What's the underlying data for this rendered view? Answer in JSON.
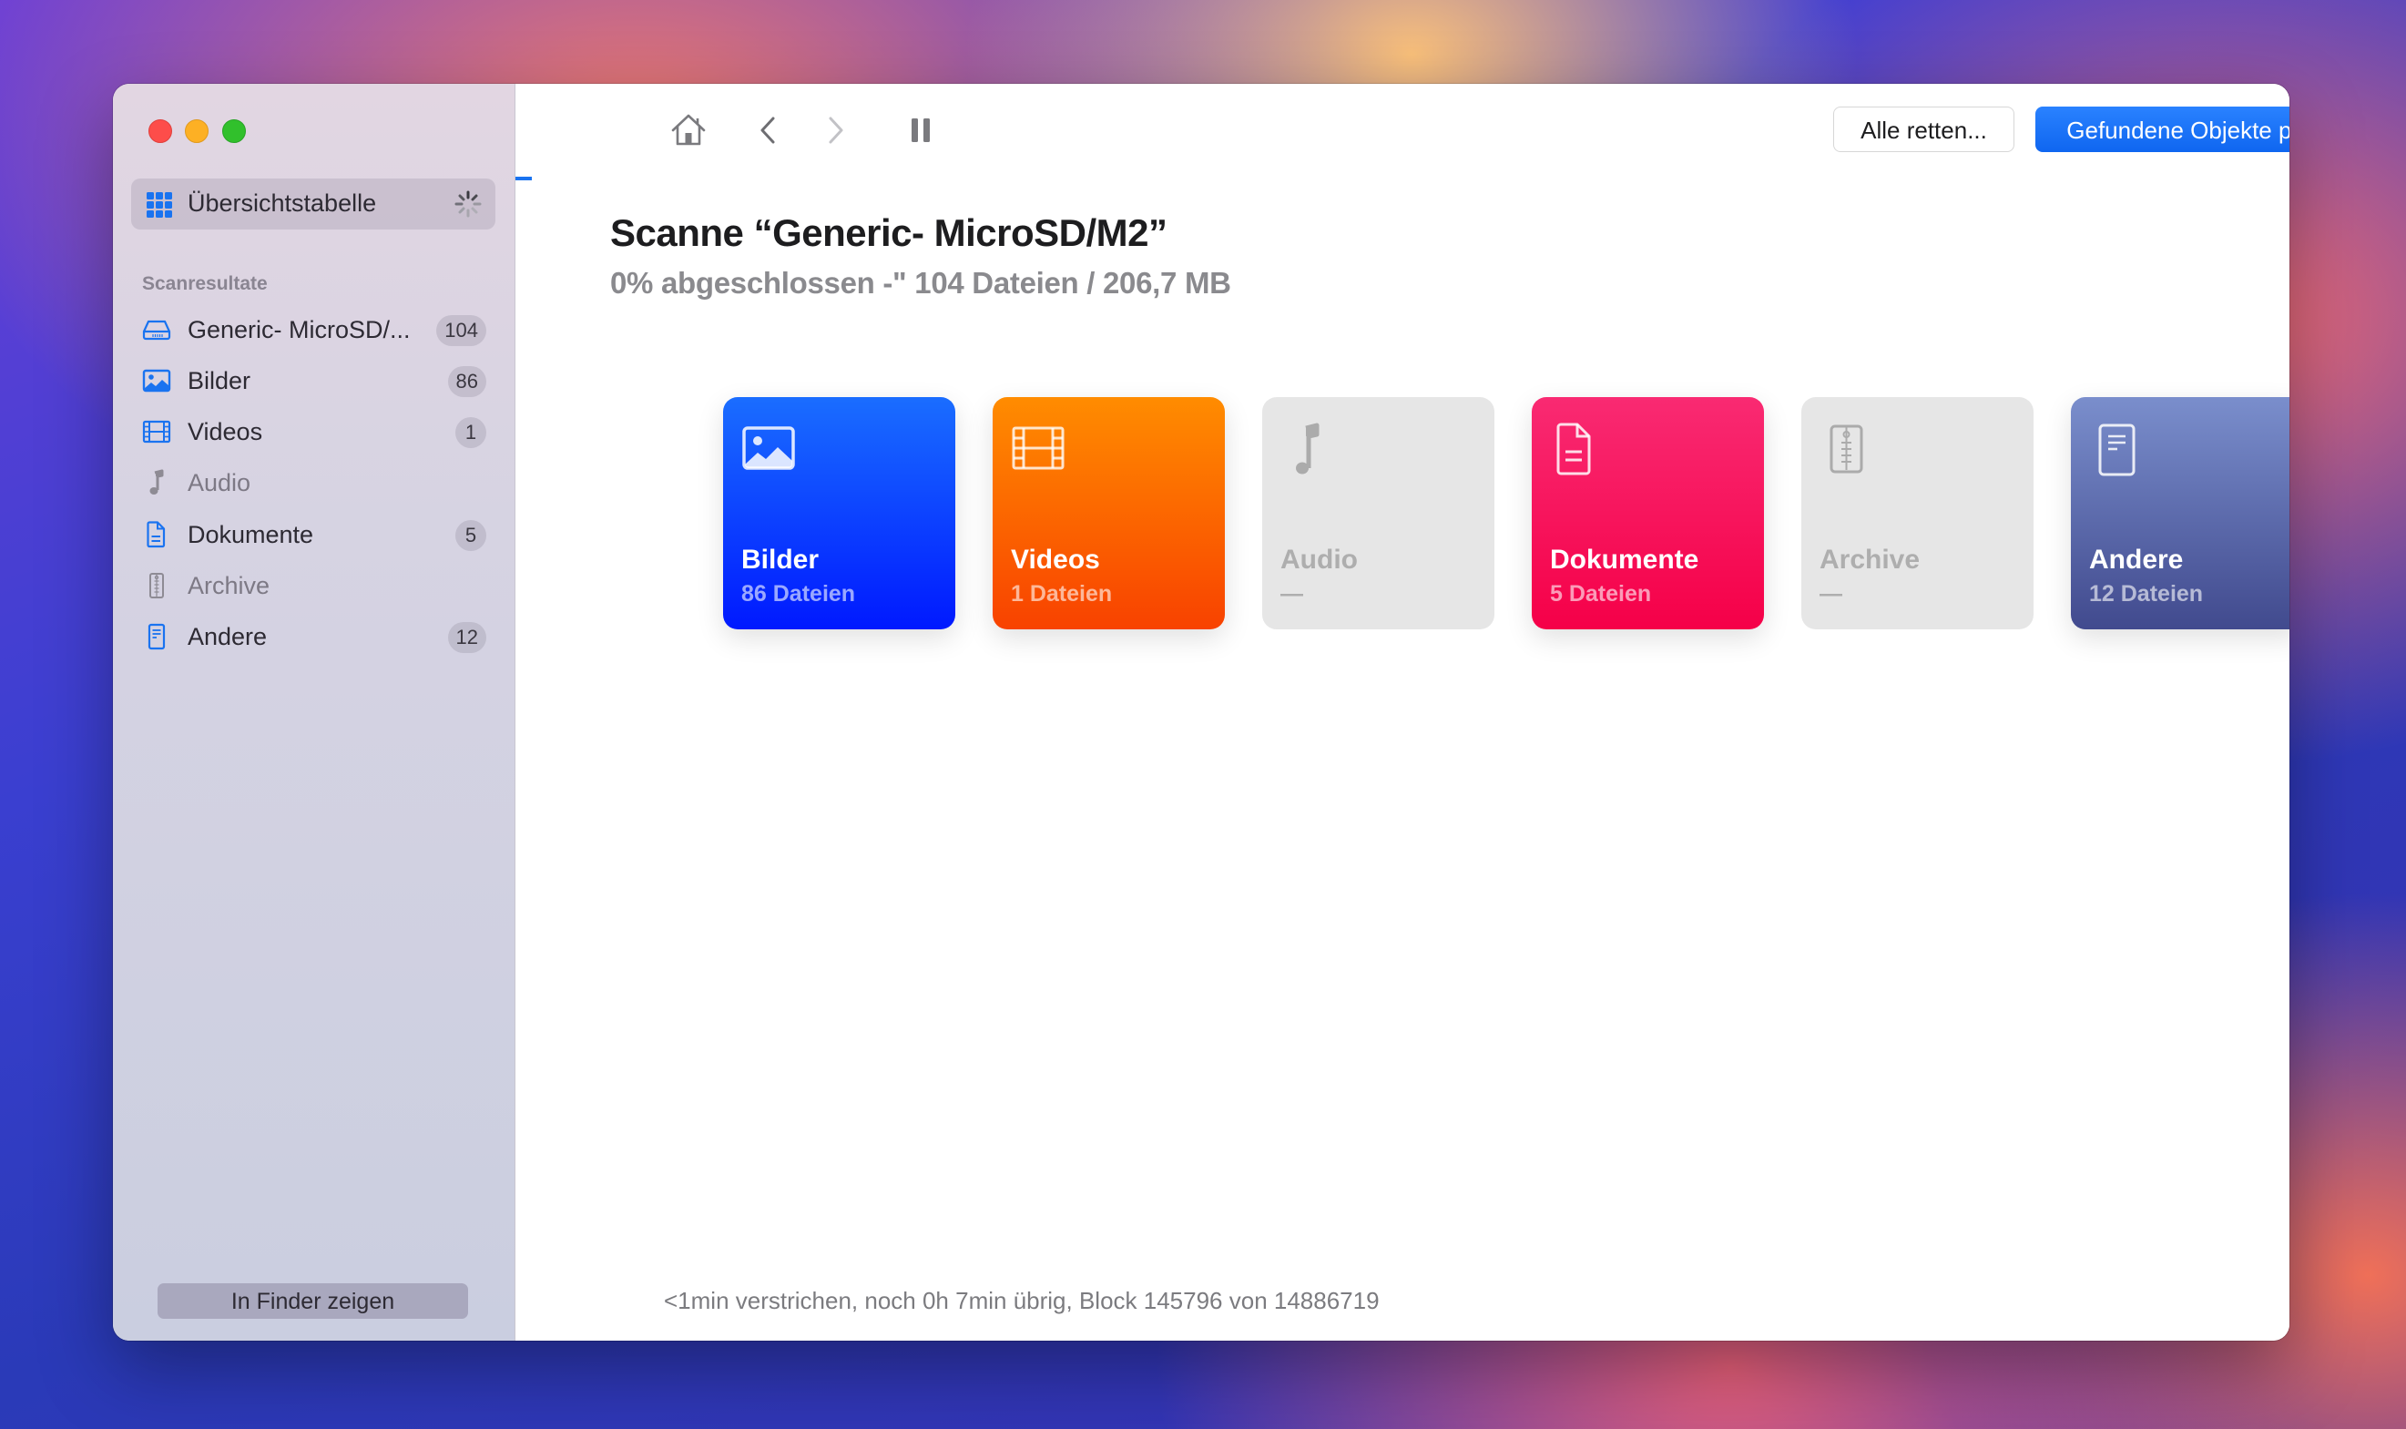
{
  "window": {
    "traffic_lights": [
      "close",
      "minimize",
      "zoom"
    ]
  },
  "sidebar": {
    "overview": {
      "label": "Übersichtstabelle",
      "icon": "grid-icon",
      "status_icon": "spinner-icon"
    },
    "section_header": "Scanresultate",
    "items": [
      {
        "label": "Generic- MicroSD/...",
        "count": "104",
        "icon": "drive-icon",
        "enabled": true
      },
      {
        "label": "Bilder",
        "count": "86",
        "icon": "photo-icon",
        "enabled": true
      },
      {
        "label": "Videos",
        "count": "1",
        "icon": "film-icon",
        "enabled": true
      },
      {
        "label": "Audio",
        "count": null,
        "icon": "music-note-icon",
        "enabled": false
      },
      {
        "label": "Dokumente",
        "count": "5",
        "icon": "document-icon",
        "enabled": true
      },
      {
        "label": "Archive",
        "count": null,
        "icon": "archive-zip-icon",
        "enabled": false
      },
      {
        "label": "Andere",
        "count": "12",
        "icon": "other-file-icon",
        "enabled": true
      }
    ],
    "finder_button": "In Finder zeigen"
  },
  "toolbar": {
    "icons": [
      "home-icon",
      "back-icon",
      "forward-icon",
      "pause-icon"
    ],
    "recover_all_label": "Alle retten...",
    "review_label": "Gefundene Objekte prüfen"
  },
  "main": {
    "title": "Scanne “Generic- MicroSD/M2”",
    "subtitle": "0% abgeschlossen -\" 104 Dateien / 206,7 MB",
    "scan_progress_percent": 0,
    "cards": [
      {
        "name": "Bilder",
        "count": "86 Dateien",
        "icon": "photo-icon",
        "active": true,
        "colors": [
          "#1a6dff",
          "#0019ff"
        ]
      },
      {
        "name": "Videos",
        "count": "1 Dateien",
        "icon": "film-icon",
        "active": true,
        "colors": [
          "#ff8c00",
          "#f84200"
        ]
      },
      {
        "name": "Audio",
        "count": "—",
        "icon": "music-note-icon",
        "active": false,
        "colors": [
          "#e6e6e6",
          "#e6e6e6"
        ]
      },
      {
        "name": "Dokumente",
        "count": "5 Dateien",
        "icon": "document-icon",
        "active": true,
        "colors": [
          "#f92a72",
          "#f50048"
        ]
      },
      {
        "name": "Archive",
        "count": "—",
        "icon": "archive-zip-icon",
        "active": false,
        "colors": [
          "#e6e6e6",
          "#e6e6e6"
        ]
      },
      {
        "name": "Andere",
        "count": "12 Dateien",
        "icon": "other-file-icon",
        "active": true,
        "colors": [
          "#7a8ecc",
          "#414a8e"
        ]
      }
    ],
    "status": "<1min verstrichen, noch 0h 7min übrig, Block 145796 von 14886719"
  },
  "colors": {
    "accent": "#1a73f0",
    "sidebar_icon": "#1a73f0"
  }
}
